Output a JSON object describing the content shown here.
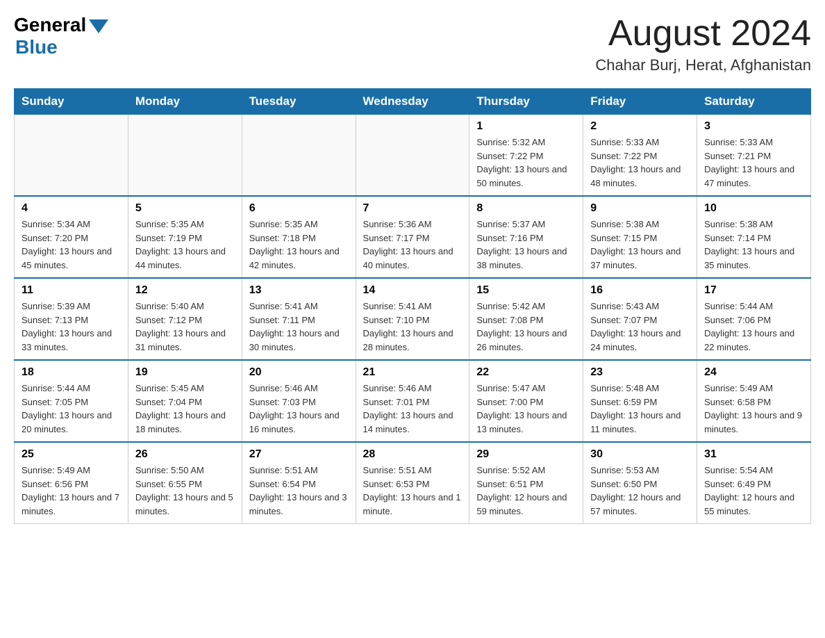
{
  "header": {
    "logo_general": "General",
    "logo_blue": "Blue",
    "month_year": "August 2024",
    "location": "Chahar Burj, Herat, Afghanistan"
  },
  "days_of_week": [
    "Sunday",
    "Monday",
    "Tuesday",
    "Wednesday",
    "Thursday",
    "Friday",
    "Saturday"
  ],
  "weeks": [
    [
      {
        "day": "",
        "info": ""
      },
      {
        "day": "",
        "info": ""
      },
      {
        "day": "",
        "info": ""
      },
      {
        "day": "",
        "info": ""
      },
      {
        "day": "1",
        "info": "Sunrise: 5:32 AM\nSunset: 7:22 PM\nDaylight: 13 hours and 50 minutes."
      },
      {
        "day": "2",
        "info": "Sunrise: 5:33 AM\nSunset: 7:22 PM\nDaylight: 13 hours and 48 minutes."
      },
      {
        "day": "3",
        "info": "Sunrise: 5:33 AM\nSunset: 7:21 PM\nDaylight: 13 hours and 47 minutes."
      }
    ],
    [
      {
        "day": "4",
        "info": "Sunrise: 5:34 AM\nSunset: 7:20 PM\nDaylight: 13 hours and 45 minutes."
      },
      {
        "day": "5",
        "info": "Sunrise: 5:35 AM\nSunset: 7:19 PM\nDaylight: 13 hours and 44 minutes."
      },
      {
        "day": "6",
        "info": "Sunrise: 5:35 AM\nSunset: 7:18 PM\nDaylight: 13 hours and 42 minutes."
      },
      {
        "day": "7",
        "info": "Sunrise: 5:36 AM\nSunset: 7:17 PM\nDaylight: 13 hours and 40 minutes."
      },
      {
        "day": "8",
        "info": "Sunrise: 5:37 AM\nSunset: 7:16 PM\nDaylight: 13 hours and 38 minutes."
      },
      {
        "day": "9",
        "info": "Sunrise: 5:38 AM\nSunset: 7:15 PM\nDaylight: 13 hours and 37 minutes."
      },
      {
        "day": "10",
        "info": "Sunrise: 5:38 AM\nSunset: 7:14 PM\nDaylight: 13 hours and 35 minutes."
      }
    ],
    [
      {
        "day": "11",
        "info": "Sunrise: 5:39 AM\nSunset: 7:13 PM\nDaylight: 13 hours and 33 minutes."
      },
      {
        "day": "12",
        "info": "Sunrise: 5:40 AM\nSunset: 7:12 PM\nDaylight: 13 hours and 31 minutes."
      },
      {
        "day": "13",
        "info": "Sunrise: 5:41 AM\nSunset: 7:11 PM\nDaylight: 13 hours and 30 minutes."
      },
      {
        "day": "14",
        "info": "Sunrise: 5:41 AM\nSunset: 7:10 PM\nDaylight: 13 hours and 28 minutes."
      },
      {
        "day": "15",
        "info": "Sunrise: 5:42 AM\nSunset: 7:08 PM\nDaylight: 13 hours and 26 minutes."
      },
      {
        "day": "16",
        "info": "Sunrise: 5:43 AM\nSunset: 7:07 PM\nDaylight: 13 hours and 24 minutes."
      },
      {
        "day": "17",
        "info": "Sunrise: 5:44 AM\nSunset: 7:06 PM\nDaylight: 13 hours and 22 minutes."
      }
    ],
    [
      {
        "day": "18",
        "info": "Sunrise: 5:44 AM\nSunset: 7:05 PM\nDaylight: 13 hours and 20 minutes."
      },
      {
        "day": "19",
        "info": "Sunrise: 5:45 AM\nSunset: 7:04 PM\nDaylight: 13 hours and 18 minutes."
      },
      {
        "day": "20",
        "info": "Sunrise: 5:46 AM\nSunset: 7:03 PM\nDaylight: 13 hours and 16 minutes."
      },
      {
        "day": "21",
        "info": "Sunrise: 5:46 AM\nSunset: 7:01 PM\nDaylight: 13 hours and 14 minutes."
      },
      {
        "day": "22",
        "info": "Sunrise: 5:47 AM\nSunset: 7:00 PM\nDaylight: 13 hours and 13 minutes."
      },
      {
        "day": "23",
        "info": "Sunrise: 5:48 AM\nSunset: 6:59 PM\nDaylight: 13 hours and 11 minutes."
      },
      {
        "day": "24",
        "info": "Sunrise: 5:49 AM\nSunset: 6:58 PM\nDaylight: 13 hours and 9 minutes."
      }
    ],
    [
      {
        "day": "25",
        "info": "Sunrise: 5:49 AM\nSunset: 6:56 PM\nDaylight: 13 hours and 7 minutes."
      },
      {
        "day": "26",
        "info": "Sunrise: 5:50 AM\nSunset: 6:55 PM\nDaylight: 13 hours and 5 minutes."
      },
      {
        "day": "27",
        "info": "Sunrise: 5:51 AM\nSunset: 6:54 PM\nDaylight: 13 hours and 3 minutes."
      },
      {
        "day": "28",
        "info": "Sunrise: 5:51 AM\nSunset: 6:53 PM\nDaylight: 13 hours and 1 minute."
      },
      {
        "day": "29",
        "info": "Sunrise: 5:52 AM\nSunset: 6:51 PM\nDaylight: 12 hours and 59 minutes."
      },
      {
        "day": "30",
        "info": "Sunrise: 5:53 AM\nSunset: 6:50 PM\nDaylight: 12 hours and 57 minutes."
      },
      {
        "day": "31",
        "info": "Sunrise: 5:54 AM\nSunset: 6:49 PM\nDaylight: 12 hours and 55 minutes."
      }
    ]
  ]
}
